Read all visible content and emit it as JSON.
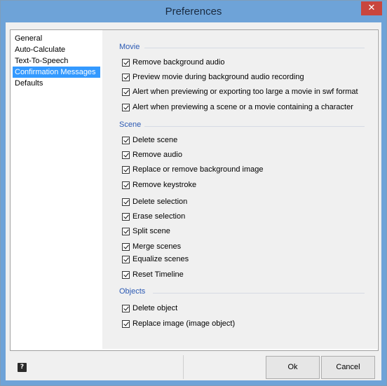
{
  "window": {
    "title": "Preferences",
    "close_glyph": "✕"
  },
  "nav": {
    "items": [
      {
        "label": "General"
      },
      {
        "label": "Auto-Calculate"
      },
      {
        "label": "Text-To-Speech"
      },
      {
        "label": "Confirmation Messages",
        "selected": true
      },
      {
        "label": "Defaults"
      }
    ]
  },
  "groups": {
    "movie": {
      "title": "Movie",
      "options": [
        {
          "label": "Remove background audio",
          "checked": true
        },
        {
          "label": "Preview movie during background audio recording",
          "checked": true
        },
        {
          "label": "Alert when previewing or exporting too large a movie in swf format",
          "checked": true
        },
        {
          "label": "Alert when previewing a scene or a movie containing a character",
          "checked": true
        }
      ]
    },
    "scene": {
      "title": "Scene",
      "options": [
        {
          "label": "Delete scene",
          "checked": true
        },
        {
          "label": "Remove audio",
          "checked": true
        },
        {
          "label": "Replace or remove background image",
          "checked": true
        },
        {
          "label": "Remove keystroke",
          "checked": true
        },
        {
          "label": "Delete selection",
          "checked": true
        },
        {
          "label": "Erase selection",
          "checked": true
        },
        {
          "label": "Split scene",
          "checked": true
        },
        {
          "label": "Merge scenes",
          "checked": true
        },
        {
          "label": "Equalize scenes",
          "checked": true
        },
        {
          "label": "Reset Timeline",
          "checked": true
        }
      ]
    },
    "objects": {
      "title": "Objects",
      "options": [
        {
          "label": "Delete object",
          "checked": true
        },
        {
          "label": "Replace image (image object)",
          "checked": true
        }
      ]
    }
  },
  "footer": {
    "help_label": "?",
    "ok_label": "Ok",
    "cancel_label": "Cancel"
  },
  "colors": {
    "titlebar": "#6ea3d8",
    "close": "#c9463d",
    "selection": "#3399ff",
    "group_title": "#2b59b3"
  }
}
